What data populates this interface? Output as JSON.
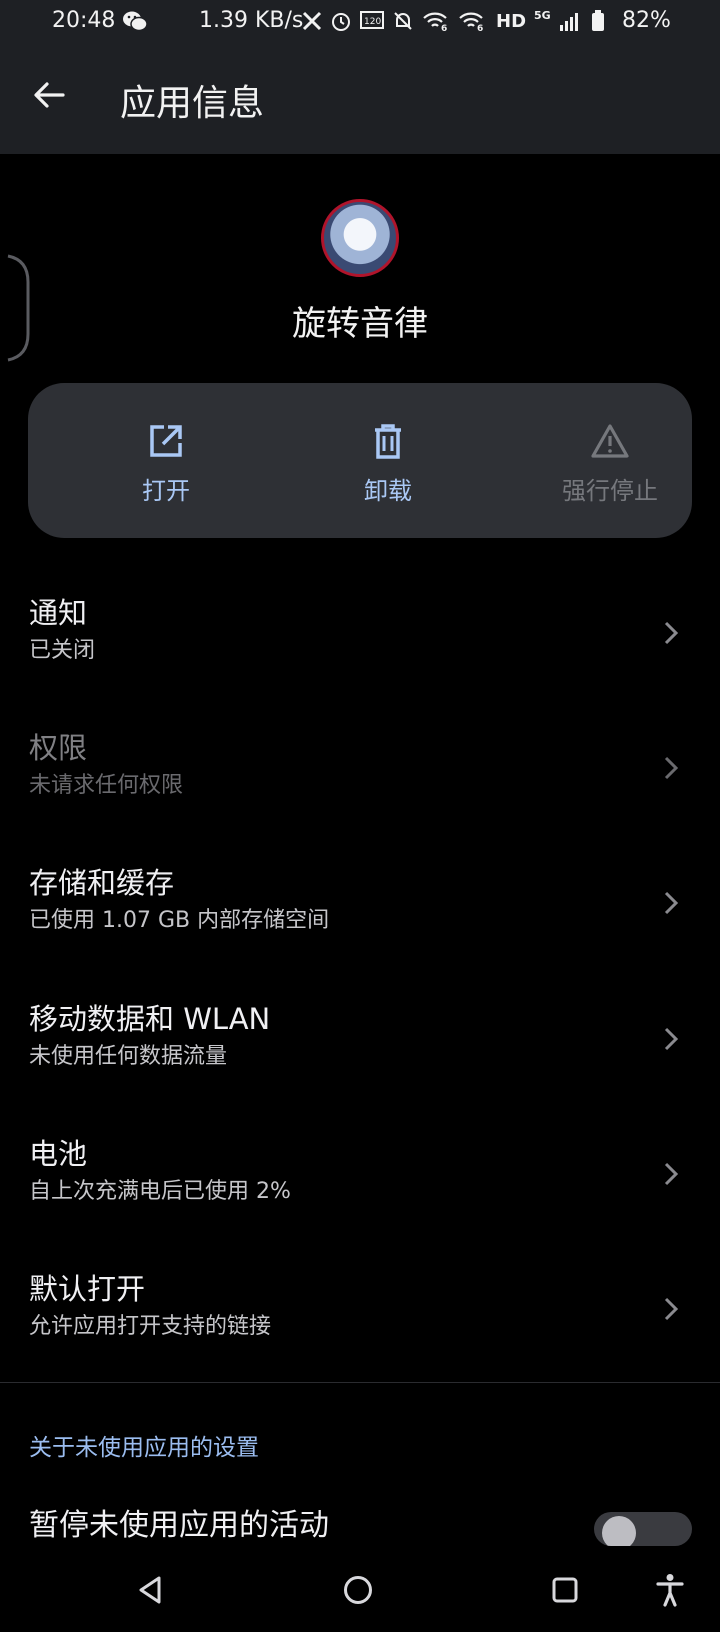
{
  "status_bar": {
    "time": "20:48",
    "net_rate": "1.39 KB/s",
    "hd": "HD",
    "network": "5G",
    "battery": "82%",
    "icons": [
      "wechat-icon",
      "x-icon",
      "alarm-icon",
      "refresh-rate-icon",
      "mute-icon",
      "wifi-6-icon",
      "wifi-6-icon",
      "signal-icon",
      "battery-icon"
    ]
  },
  "app_bar": {
    "title": "应用信息"
  },
  "app": {
    "name": "旋转音律"
  },
  "actions": {
    "open": "打开",
    "uninstall": "卸载",
    "force_stop": "强行停止"
  },
  "settings": [
    {
      "title": "通知",
      "subtitle": "已关闭",
      "enabled": true
    },
    {
      "title": "权限",
      "subtitle": "未请求任何权限",
      "enabled": false
    },
    {
      "title": "存储和缓存",
      "subtitle": "已使用 1.07 GB 内部存储空间",
      "enabled": true
    },
    {
      "title": "移动数据和 WLAN",
      "subtitle": "未使用任何数据流量",
      "enabled": true
    },
    {
      "title": "电池",
      "subtitle": "自上次充满电后已使用 2%",
      "enabled": true
    },
    {
      "title": "默认打开",
      "subtitle": "允许应用打开支持的链接",
      "enabled": true
    }
  ],
  "unused_apps": {
    "section_header": "关于未使用应用的设置",
    "pause_title": "暂停未使用应用的活动",
    "pause_enabled": false
  },
  "colors": {
    "accent": "#aac8f5",
    "surface": "#2e3035",
    "background": "#000000"
  }
}
